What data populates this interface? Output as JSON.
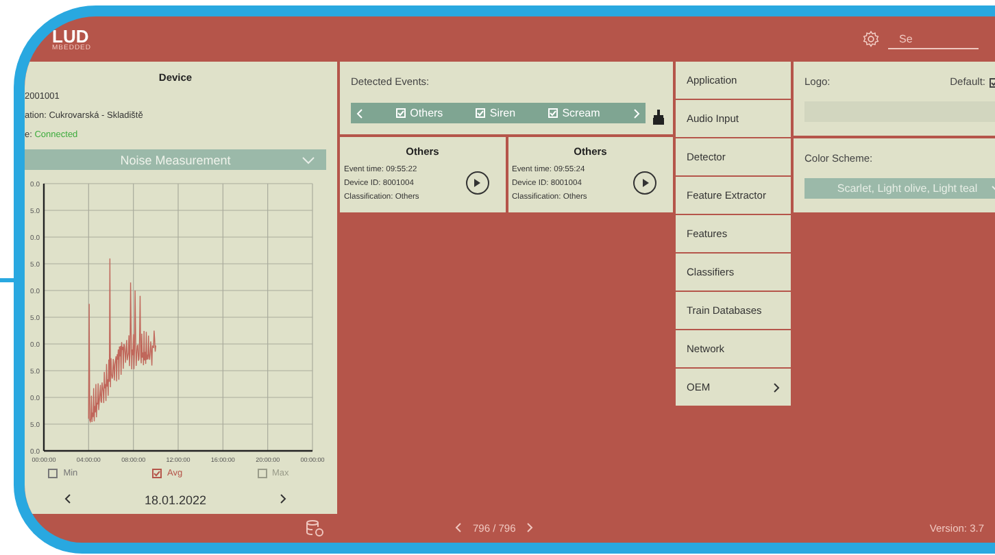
{
  "header": {
    "logo_title": "LUD",
    "logo_subtitle": "MBEDDED",
    "search": {
      "value": "Se"
    }
  },
  "device": {
    "title": "Device",
    "lines": [
      {
        "value": "2001001",
        "kind": "plain"
      },
      {
        "label": "ation:",
        "value": "Cukrovarská - Skladiště",
        "kind": "plain"
      },
      {
        "label": "e:",
        "value": "Connected",
        "kind": "status"
      }
    ],
    "view_select": "Noise Measurement",
    "chart": {
      "y_tick_labels": [
        "0.0",
        "5.0",
        "0.0",
        "5.0",
        "0.0",
        "5.0",
        "0.0",
        "5.0",
        "0.0",
        "5.0",
        "0.0"
      ],
      "x_tick_labels": [
        "00:00:00",
        "04:00:00",
        "08:00:00",
        "12:00:00",
        "16:00:00",
        "20:00:00",
        "00:00:00"
      ]
    },
    "legend": [
      {
        "label": "Min",
        "checked": false,
        "disabled": false
      },
      {
        "label": "Avg",
        "checked": true,
        "disabled": false
      },
      {
        "label": "Max",
        "checked": false,
        "disabled": true
      }
    ],
    "date": "18.01.2022"
  },
  "detected_events": {
    "title": "Detected Events:",
    "filters": [
      {
        "label": "Others",
        "checked": true
      },
      {
        "label": "Siren",
        "checked": true
      },
      {
        "label": "Scream",
        "checked": true
      }
    ]
  },
  "events": [
    {
      "title": "Others",
      "lines": [
        "Event time:  09:55:22",
        "Device ID:  8001004",
        "Classification:  Others"
      ]
    },
    {
      "title": "Others",
      "lines": [
        "Event time:  09:55:24",
        "Device ID:  8001004",
        "Classification:  Others"
      ]
    }
  ],
  "menu": [
    {
      "label": "Application",
      "kind": "plain"
    },
    {
      "label": "Audio Input",
      "kind": "plain"
    },
    {
      "label": "Detector",
      "kind": "plain"
    },
    {
      "label": "Feature Extractor",
      "kind": "plain"
    },
    {
      "label": "Features",
      "kind": "plain"
    },
    {
      "label": "Classifiers",
      "kind": "plain"
    },
    {
      "label": "Train Databases",
      "kind": "plain"
    },
    {
      "label": "Network",
      "kind": "plain"
    },
    {
      "label": "OEM",
      "kind": "submenu"
    }
  ],
  "settings": {
    "logo_label": "Logo:",
    "default_label": "Default:",
    "default_checked": true,
    "color_scheme_label": "Color Scheme:",
    "color_scheme": "Scarlet, Light olive, Light teal"
  },
  "footer": {
    "pager": "796 / 796",
    "version": "Version: 3.7"
  }
}
